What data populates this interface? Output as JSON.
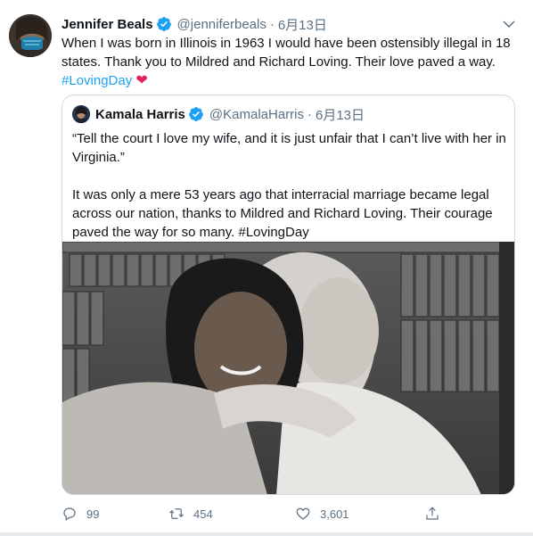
{
  "tweet": {
    "author_name": "Jennifer Beals",
    "handle": "@jenniferbeals",
    "separator": "·",
    "date": "6月13日",
    "text_main": "When I was born in Illinois in 1963 I would have been ostensibly illegal in 18 states. Thank you to Mildred and Richard Loving. Their love paved a way. ",
    "hashtag": "#LovingDay",
    "emoji": "❤"
  },
  "quote": {
    "author_name": "Kamala Harris",
    "handle": "@KamalaHarris",
    "separator": "·",
    "date": "6月13日",
    "paragraph1": "“Tell the court I love my wife, and it is just unfair that I can’t live with her in Virginia.”",
    "paragraph2": "It was only a mere 53 years ago that interracial marriage became legal across our nation, thanks to Mildred and Richard Loving. Their courage paved the way for so many. #LovingDay"
  },
  "actions": {
    "replies": "99",
    "retweets": "454",
    "likes": "3,601"
  },
  "icons": {
    "verified": "verified-badge-icon",
    "caret": "chevron-down-icon",
    "reply": "reply-icon",
    "retweet": "retweet-icon",
    "like": "heart-icon",
    "share": "share-icon"
  },
  "colors": {
    "accent": "#1da1f2",
    "muted": "#5b7083",
    "heart": "#e0245e",
    "border": "#cfd9de"
  }
}
